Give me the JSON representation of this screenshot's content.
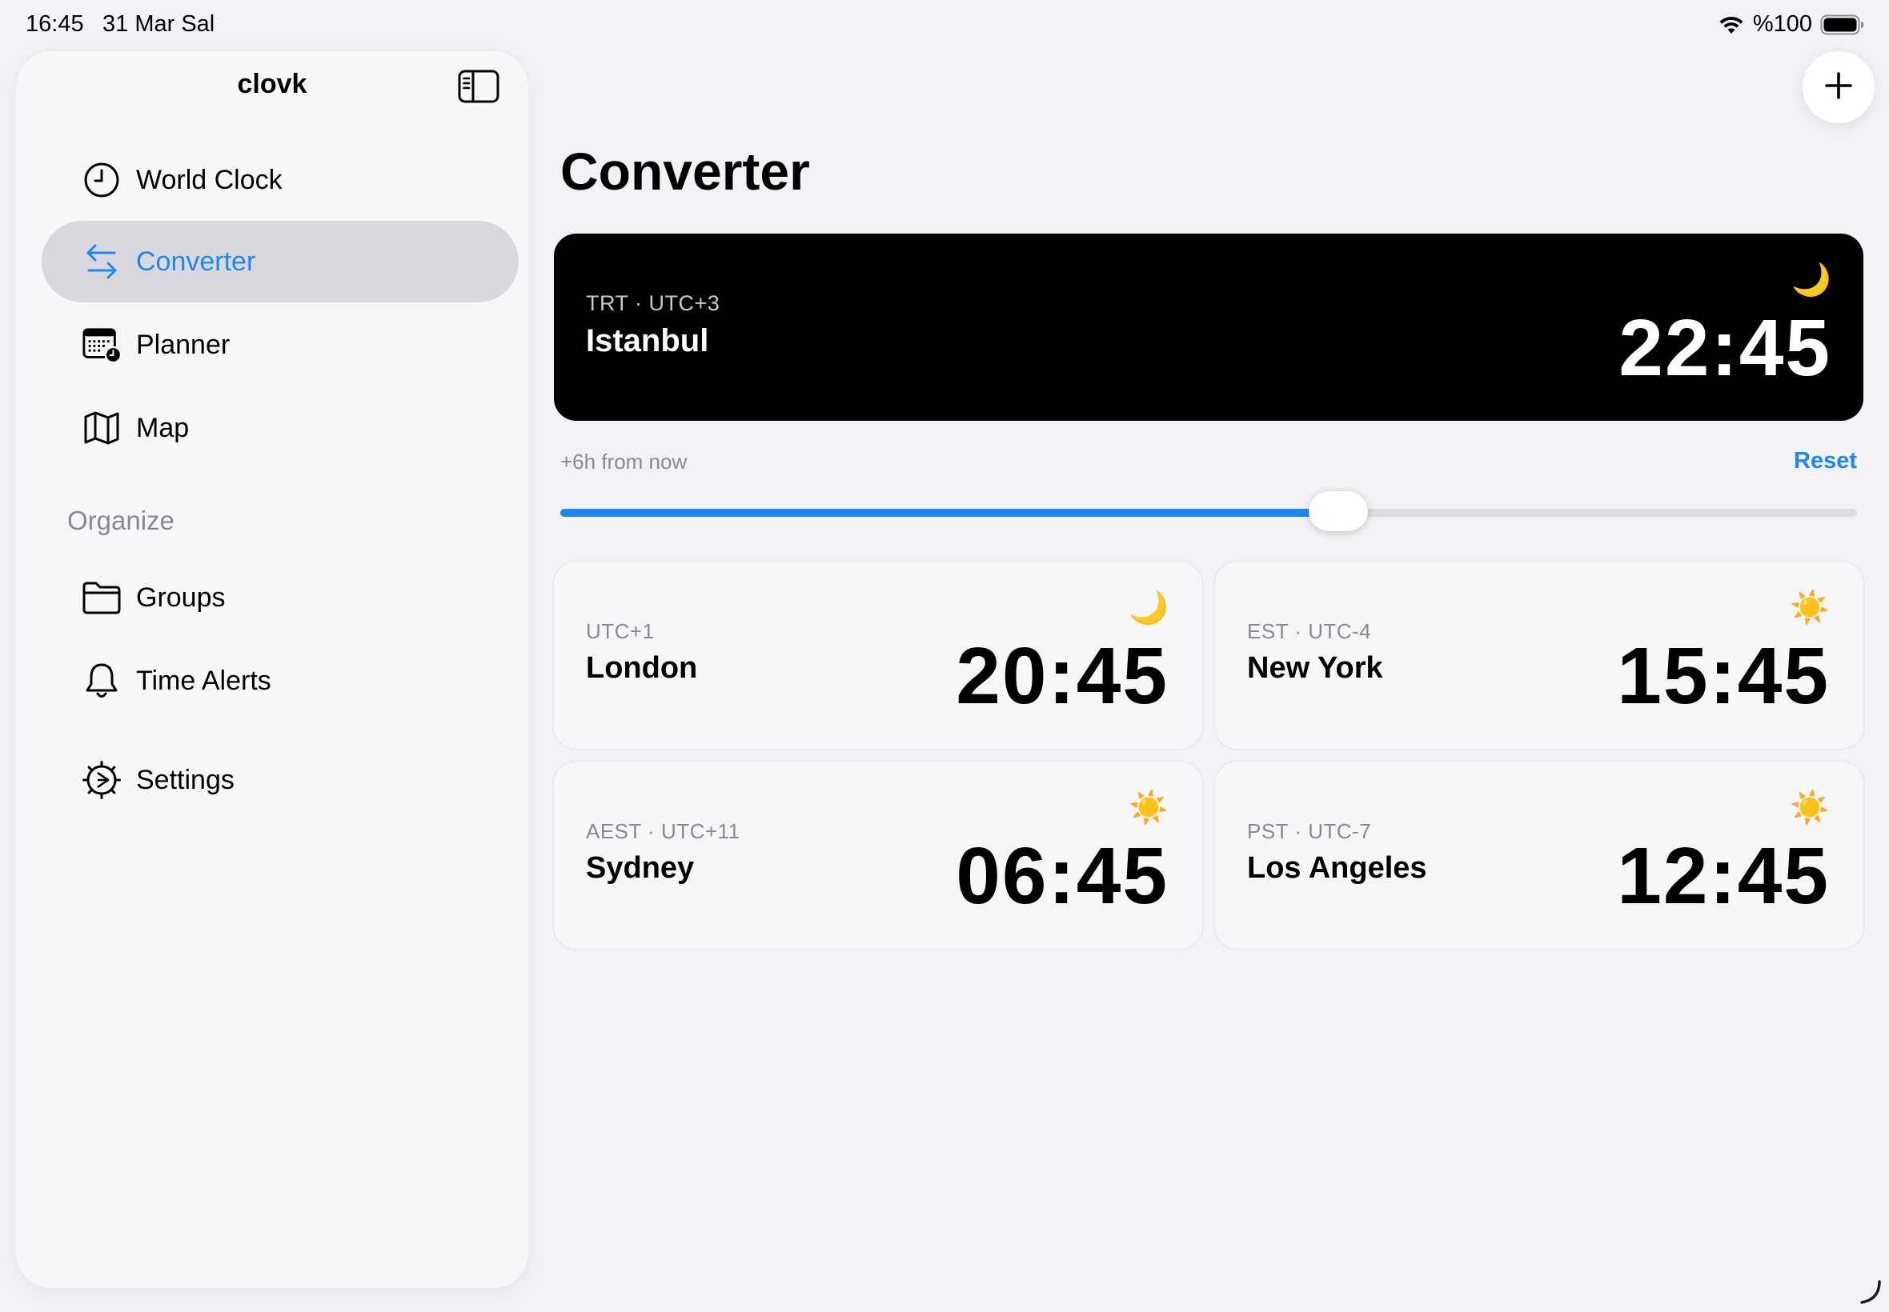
{
  "status_bar": {
    "time": "16:45",
    "date": "31 Mar Sal",
    "battery_text": "%100",
    "icons": [
      "wifi-icon",
      "battery-icon"
    ]
  },
  "sidebar": {
    "title": "clovk",
    "toggle_icon": "sidebar-toggle-icon",
    "items": [
      {
        "label": "World Clock",
        "icon": "clock-icon",
        "active": false
      },
      {
        "label": "Converter",
        "icon": "arrows-left-right-icon",
        "active": true
      },
      {
        "label": "Planner",
        "icon": "calendar-clock-icon",
        "active": false
      },
      {
        "label": "Map",
        "icon": "map-icon",
        "active": false
      }
    ],
    "section_header": "Organize",
    "organize_items": [
      {
        "label": "Groups",
        "icon": "folder-icon"
      },
      {
        "label": "Time Alerts",
        "icon": "bell-icon"
      }
    ],
    "settings": {
      "label": "Settings",
      "icon": "gear-icon"
    }
  },
  "main": {
    "title": "Converter",
    "add_button_icon": "plus-icon",
    "hero": {
      "tz": "TRT · UTC+3",
      "city": "Istanbul",
      "time": "22:45",
      "daynight": "moon"
    },
    "offset_label": "+6h from now",
    "reset_label": "Reset",
    "slider": {
      "value": 0.6
    },
    "clocks": [
      {
        "tz": "UTC+1",
        "city": "London",
        "time": "20:45",
        "daynight": "moon"
      },
      {
        "tz": "EST · UTC-4",
        "city": "New York",
        "time": "15:45",
        "daynight": "sun"
      },
      {
        "tz": "AEST · UTC+11",
        "city": "Sydney",
        "time": "06:45",
        "daynight": "sun"
      },
      {
        "tz": "PST · UTC-7",
        "city": "Los Angeles",
        "time": "12:45",
        "daynight": "sun"
      }
    ]
  },
  "colors": {
    "accent": "#1e86f0",
    "background": "#f2f2f6",
    "hero_background": "#000000",
    "secondary_text": "#8a8a8e"
  }
}
